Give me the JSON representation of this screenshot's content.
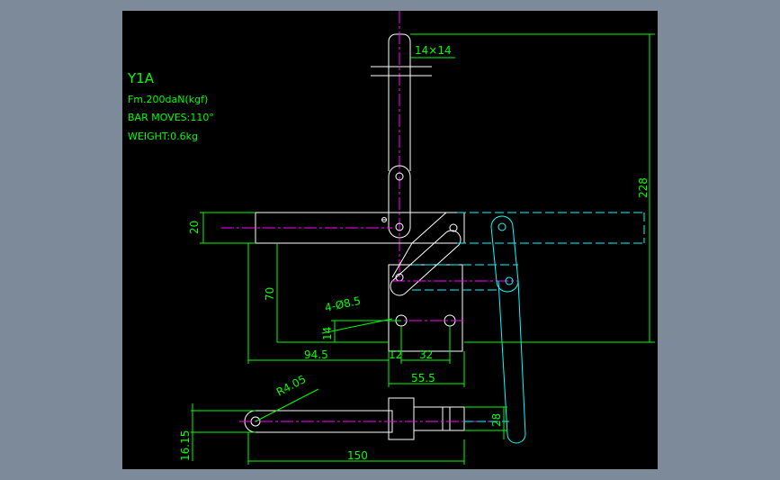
{
  "drawing": {
    "model": "Y1A",
    "specs": [
      "Fm.200daN(kgf)",
      "BAR MOVES:110°",
      "WEIGHT:0.6kg"
    ]
  },
  "dimensions": {
    "d_14x14": "14×14",
    "d_228": "228",
    "d_20": "20",
    "d_70": "70",
    "d_14": "14",
    "d_hole": "4-Ø8.5",
    "d_94_5": "94.5",
    "d_12": "12",
    "d_32": "32",
    "d_55_5": "55.5",
    "d_r4_05": "R4.05",
    "d_28": "28",
    "d_16_15": "16.15",
    "d_150": "150"
  },
  "colors": {
    "viewport_bg": "#7d8a99",
    "canvas_bg": "#000000",
    "dimension": "#00ff00",
    "outline": "#ffffff",
    "hidden": "#00ffff",
    "centerline": "#ff00ff"
  }
}
